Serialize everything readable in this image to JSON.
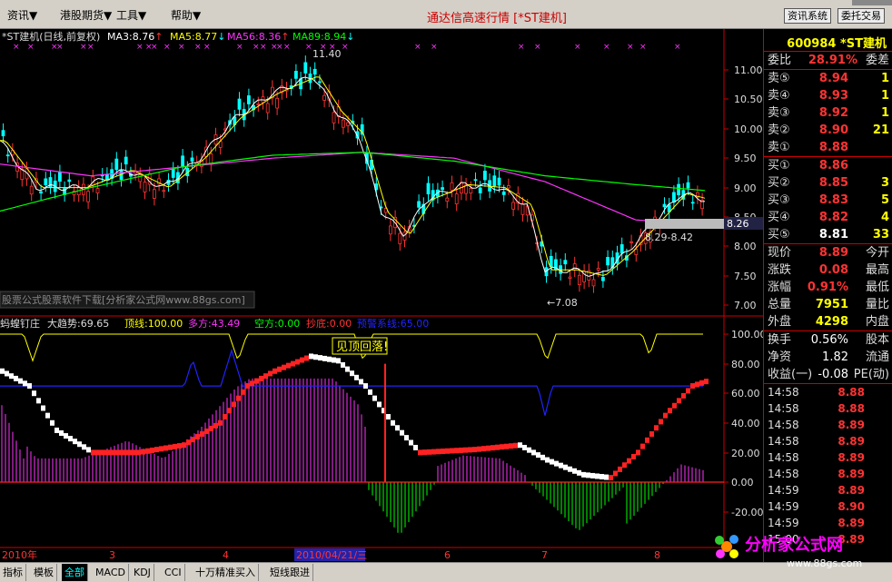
{
  "menu": {
    "items": [
      "资讯",
      "港股期货",
      "工具",
      "帮助"
    ],
    "arrows": [
      "▼",
      "▼",
      "▼",
      "▼"
    ]
  },
  "app_title": "通达信高速行情 [*ST建机]",
  "sys_buttons": [
    "资讯系统",
    "委托交易"
  ],
  "main_chart": {
    "title": "*ST建机(日线,前复权)",
    "ma": [
      {
        "label": "MA3:8.76",
        "arrow": "↑",
        "color": "#ffffff"
      },
      {
        "label": "MA5:8.77",
        "arrow": "↓",
        "color": "#ffff00"
      },
      {
        "label": "MA56:8.36",
        "arrow": "↑",
        "color": "#ff33ff"
      },
      {
        "label": "MA89:8.94",
        "arrow": "↓",
        "color": "#00ff00"
      }
    ],
    "y_ticks": [
      "11.00",
      "10.50",
      "10.00",
      "9.50",
      "9.00",
      "8.50",
      "8.00",
      "7.50",
      "7.00"
    ],
    "high_label": "11.40",
    "low_label": "←7.08",
    "range_label": "8.29-8.42",
    "current_price_tag": "8.26",
    "watermark": "股票公式股票软件下载[分析家公式网www.88gs.com]"
  },
  "indicator": {
    "name": "蚂蝗钉庄",
    "trend": "大趋势:69.65",
    "top": "顶线:100.00",
    "long": "多方:43.49",
    "short": "空方:0.00",
    "bottom": "抄底:0.00",
    "warn": "预警系线:65.00",
    "callout": "见顶回落!",
    "y_ticks": [
      "100.00",
      "80.00",
      "60.00",
      "40.00",
      "20.00",
      "0.00",
      "-20.00"
    ]
  },
  "x_axis": {
    "labels": [
      "2010年",
      "3",
      "4",
      "2010/04/21/三",
      "6",
      "7",
      "8"
    ]
  },
  "right_panel": {
    "code_name": "600984 *ST建机",
    "weibi": {
      "label": "委比",
      "value": "28.91%",
      "label2": "委差"
    },
    "asks": [
      {
        "label": "卖⑤",
        "price": "8.94",
        "vol": "1"
      },
      {
        "label": "卖④",
        "price": "8.93",
        "vol": "1"
      },
      {
        "label": "卖③",
        "price": "8.92",
        "vol": "1"
      },
      {
        "label": "卖②",
        "price": "8.90",
        "vol": "21"
      },
      {
        "label": "卖①",
        "price": "8.88",
        "vol": ""
      }
    ],
    "bids": [
      {
        "label": "买①",
        "price": "8.86",
        "vol": ""
      },
      {
        "label": "买②",
        "price": "8.85",
        "vol": "3"
      },
      {
        "label": "买③",
        "price": "8.83",
        "vol": "5"
      },
      {
        "label": "买④",
        "price": "8.82",
        "vol": "4"
      },
      {
        "label": "买⑤",
        "price": "8.81",
        "vol": "33"
      }
    ],
    "stats": [
      {
        "l": "现价",
        "v": "8.89",
        "r": "今开"
      },
      {
        "l": "涨跌",
        "v": "0.08",
        "r": "最高"
      },
      {
        "l": "涨幅",
        "v": "0.91%",
        "r": "最低"
      },
      {
        "l": "总量",
        "v": "7951",
        "r": "量比"
      },
      {
        "l": "外盘",
        "v": "4298",
        "r": "内盘"
      }
    ],
    "stats2": [
      {
        "l": "换手",
        "v": "0.56%",
        "r": "股本"
      },
      {
        "l": "净资",
        "v": "1.82",
        "r": "流通"
      },
      {
        "l": "收益(一)",
        "v": "-0.08",
        "r": "PE(动)"
      }
    ],
    "ticks": [
      {
        "t": "14:58",
        "p": "8.88"
      },
      {
        "t": "14:58",
        "p": "8.88"
      },
      {
        "t": "14:58",
        "p": "8.89"
      },
      {
        "t": "14:58",
        "p": "8.89"
      },
      {
        "t": "14:58",
        "p": "8.89"
      },
      {
        "t": "14:58",
        "p": "8.89"
      },
      {
        "t": "14:59",
        "p": "8.89"
      },
      {
        "t": "14:59",
        "p": "8.90"
      },
      {
        "t": "14:59",
        "p": "8.89"
      },
      {
        "t": "15:00",
        "p": "8.89"
      }
    ]
  },
  "bottom_tabs": [
    "指标",
    "模板",
    "全部",
    "MACD",
    "KDJ",
    "CCI",
    "十万精准买入",
    "短线跟进"
  ],
  "logo": {
    "text": "分析家公式网",
    "url": "www.88gs.com"
  },
  "colors": {
    "up": "#ff3333",
    "down": "#00ffff",
    "ma3": "#ffffff",
    "ma5": "#ffff00",
    "ma56": "#ff33ff",
    "ma89": "#00ff00",
    "accent": "#c00000"
  }
}
